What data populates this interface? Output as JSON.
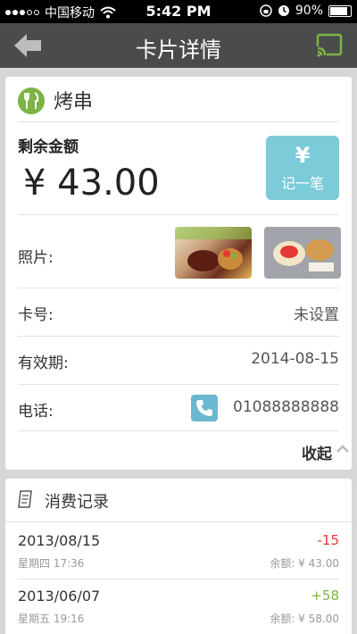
{
  "status_bar": {
    "carrier": "中国移动",
    "time": "5:42 PM",
    "battery": "90%"
  },
  "nav": {
    "title": "卡片详情"
  },
  "card": {
    "merchant": "烤串",
    "balance_label": "剩余金额",
    "balance": "¥ 43.00",
    "record_button": {
      "icon": "¥",
      "label": "记一笔"
    },
    "photos_label": "照片:",
    "card_no_label": "卡号:",
    "card_no_value": "未设置",
    "expiry_label": "有效期:",
    "expiry_value": "2014-08-15",
    "phone_label": "电话:",
    "phone_value": "01088888888",
    "collapse_label": "收起"
  },
  "history": {
    "title": "消费记录",
    "items": [
      {
        "date": "2013/08/15",
        "weekday_time": "星期四 17:36",
        "amount": "-15",
        "balance": "余额: ¥ 43.00",
        "amount_color": "#e53935"
      },
      {
        "date": "2013/06/07",
        "weekday_time": "星期五 19:16",
        "amount": "+58",
        "balance": "余额: ¥ 58.00",
        "amount_color": "#7cb342"
      }
    ]
  },
  "colors": {
    "accent": "#7bcbd9",
    "nav_bg": "#4a4b4b",
    "merchant_icon": "#7cb342"
  }
}
